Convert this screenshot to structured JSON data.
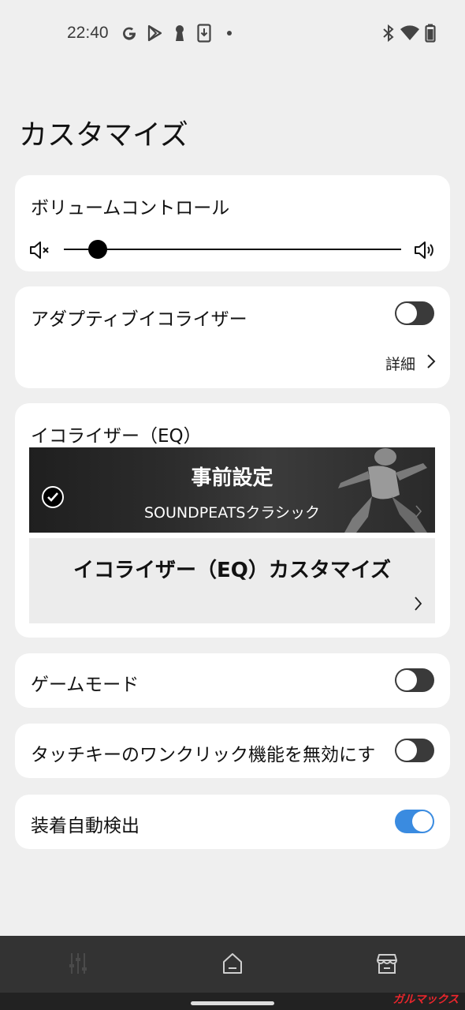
{
  "status_bar": {
    "time": "22:40",
    "left_icons": [
      "google-icon",
      "play-store-icon",
      "keyhole-icon",
      "download-icon",
      "dot-icon"
    ],
    "right_icons": [
      "bluetooth-icon",
      "wifi-icon",
      "battery-icon"
    ]
  },
  "page": {
    "title": "カスタマイズ"
  },
  "volume": {
    "label": "ボリュームコントロール",
    "level": 0.1,
    "icons": [
      "volume-mute-icon",
      "volume-up-icon"
    ]
  },
  "adaptive_eq": {
    "label": "アダプティブイコライザー",
    "enabled": false,
    "detail_label": "詳細"
  },
  "equalizer": {
    "label": "イコライザー（EQ）",
    "preset": {
      "title": "事前設定",
      "subtitle": "SOUNDPEATSクラシック",
      "selected": true
    },
    "custom": {
      "title": "イコライザー（EQ）カスタマイズ"
    }
  },
  "game_mode": {
    "label": "ゲームモード",
    "enabled": false
  },
  "touch_key": {
    "label": "タッチキーのワンクリック機能を無効にす",
    "enabled": false
  },
  "auto_detect": {
    "label": "装着自動検出",
    "enabled": true
  },
  "bottom_nav": {
    "items": [
      "equalizer-icon",
      "home-icon",
      "store-icon"
    ]
  },
  "watermark": "ガルマックス",
  "colors": {
    "background": "#efefef",
    "card": "#ffffff",
    "toggle_off": "#3a3a3a",
    "toggle_on": "#3a8be0",
    "nav_bar": "#333333"
  }
}
